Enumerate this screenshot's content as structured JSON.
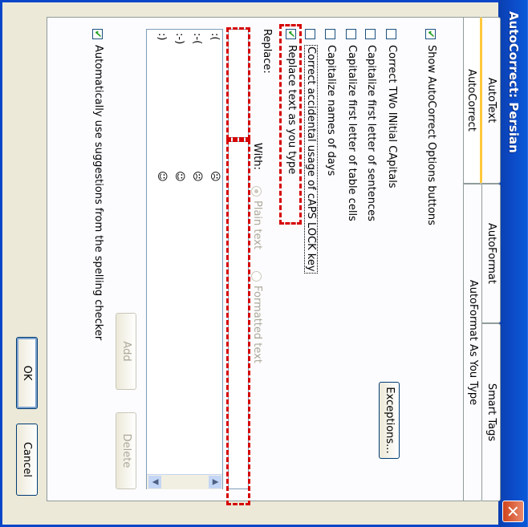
{
  "window": {
    "title": "AutoCorrect: Persian",
    "close_glyph": "✕"
  },
  "tabs_back": [
    {
      "label": "AutoText"
    },
    {
      "label": "AutoFormat"
    },
    {
      "label": "Smart Tags"
    }
  ],
  "tabs_front": [
    {
      "label": "AutoCorrect"
    },
    {
      "label": "AutoFormat As You Type"
    }
  ],
  "options": {
    "show_buttons": "Show AutoCorrect Options buttons",
    "two_initial_caps": "Correct TWo INitial CApitals",
    "first_letter_sentences": "Capitalize first letter of sentences",
    "first_letter_table": "Capitalize first letter of table cells",
    "names_of_days": "Capitalize names of days",
    "caps_lock": "Correct accidental usage of cAPS LOCK key",
    "replace_as_type": "Replace text as you type",
    "exceptions_button": "Exceptions..."
  },
  "replace": {
    "replace_label": "Replace:",
    "with_label": "With:",
    "plain_text": "Plain text",
    "formatted_text": "Formatted text"
  },
  "entries": [
    {
      "key": ":(",
      "value": "☹"
    },
    {
      "key": ":-(",
      "value": "☹"
    },
    {
      "key": ":-)",
      "value": "☺"
    },
    {
      "key": ":)",
      "value": "☺"
    }
  ],
  "list_buttons": {
    "add": "Add",
    "delete": "Delete"
  },
  "suggestions": "Automatically use suggestions from the spelling checker",
  "dialog_buttons": {
    "ok": "OK",
    "cancel": "Cancel"
  }
}
